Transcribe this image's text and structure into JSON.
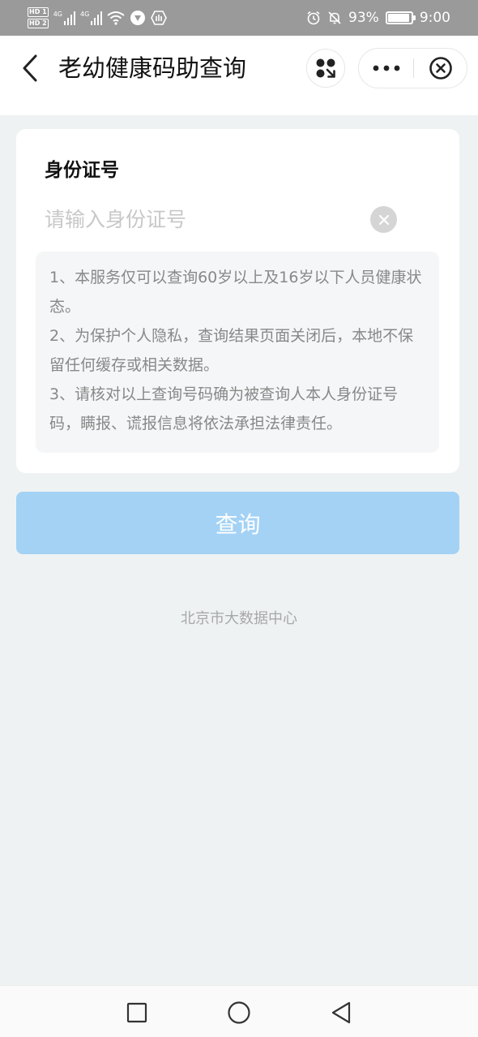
{
  "status_bar": {
    "hd1": "HD 1",
    "hd2": "HD 2",
    "network1": "4G",
    "network2": "4G",
    "battery_percent": "93%",
    "battery_level": 0.93,
    "time": "9:00",
    "icons": [
      "hd-icon",
      "signal-icon",
      "wifi-icon",
      "app-notification-icon",
      "alarm-icon",
      "mute-icon",
      "battery-icon"
    ]
  },
  "nav": {
    "title": "老幼健康码助查询",
    "icons": [
      "back-icon",
      "mini-program-icon",
      "more-icon",
      "close-icon"
    ]
  },
  "form": {
    "id_label": "身份证号",
    "id_value": "",
    "id_placeholder": "请输入身份证号",
    "notices": [
      "1、本服务仅可以查询60岁以上及16岁以下人员健康状态。",
      "2、为保护个人隐私，查询结果页面关闭后，本地不保留任何缓存或相关数据。",
      "3、请核对以上查询号码确为被查询人本人身份证号码，瞒报、谎报信息将依法承担法律责任。"
    ]
  },
  "query_button": "查询",
  "footer": "北京市大数据中心",
  "colors": {
    "status_bar_bg": "#9a9a9a",
    "page_bg": "#eff2f3",
    "button_disabled": "#a3d2f5",
    "notice_text": "#888888",
    "footer_text": "#a8a8a8"
  },
  "system_nav": {
    "icons": [
      "recent-apps-icon",
      "home-icon",
      "back-nav-icon"
    ]
  }
}
